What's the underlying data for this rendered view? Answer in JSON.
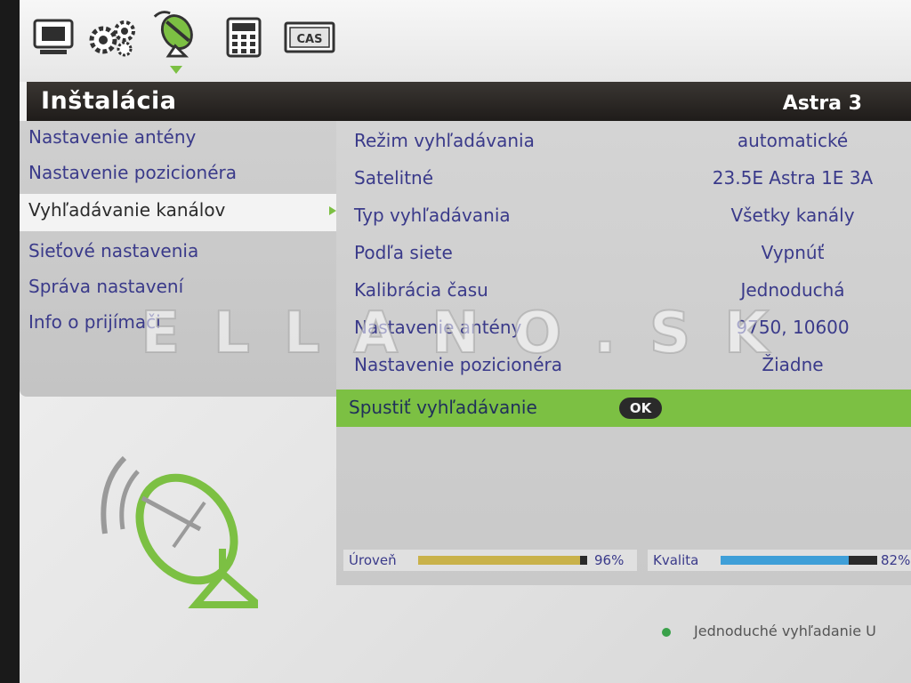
{
  "header": {
    "title": "Inštalácia",
    "satellite": "Astra 3"
  },
  "topbar": {
    "icons": [
      "tv-icon",
      "settings-gears-icon",
      "satellite-icon",
      "calculator-icon",
      "cas-card-icon"
    ],
    "cas_label": "CAS",
    "active_index": 2
  },
  "menu": {
    "items": [
      {
        "label": "Nastavenie antény"
      },
      {
        "label": "Nastavenie pozicionéra"
      },
      {
        "label": "Vyhľadávanie kanálov"
      },
      {
        "label": "Sieťové nastavenia"
      },
      {
        "label": "Správa nastavení"
      },
      {
        "label": "Info o prijímači"
      }
    ],
    "active_index": 2
  },
  "settings": {
    "rows": [
      {
        "label": "Režim vyhľadávania",
        "value": "automatické"
      },
      {
        "label": "Satelitné",
        "value": "23.5E Astra 1E 3A"
      },
      {
        "label": "Typ vyhľadávania",
        "value": "Všetky kanály"
      },
      {
        "label": "Podľa siete",
        "value": "Vypnúť"
      },
      {
        "label": "Kalibrácia času",
        "value": "Jednoduchá"
      },
      {
        "label": "Nastavenie antény",
        "value": "9750, 10600"
      },
      {
        "label": "Nastavenie pozicionéra",
        "value": "Žiadne"
      }
    ],
    "action": {
      "label": "Spustiť vyhľadávanie",
      "button": "OK"
    }
  },
  "signal": {
    "level_label": "Úroveň",
    "level_text": "96%",
    "level": 0.96,
    "quality_label": "Kvalita",
    "quality_text": "82%",
    "quality": 0.82
  },
  "watermark": "ELLANO.SK",
  "hint": "Jednoduché vyhľadanie U",
  "colors": {
    "accent_green": "#7cc043",
    "text_blue": "#3a3a8a",
    "level_bar": "#c9b24a",
    "quality_bar": "#3f9fd8"
  }
}
